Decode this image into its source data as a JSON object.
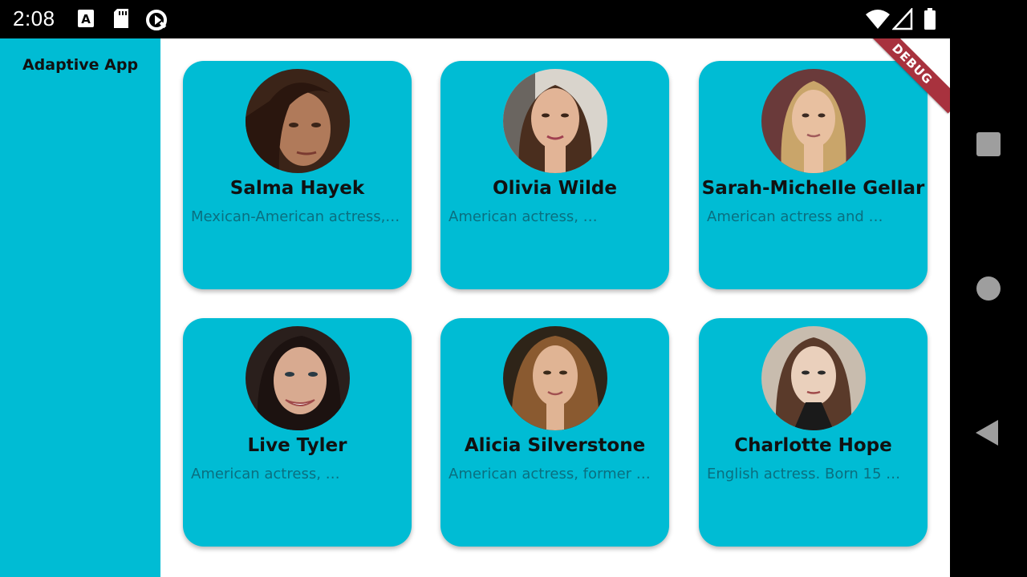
{
  "status_bar": {
    "time": "2:08",
    "left_icons": [
      "font-download-icon",
      "sd-card-icon",
      "sync-icon"
    ],
    "right_icons": [
      "wifi-icon",
      "cell-signal-icon",
      "battery-icon"
    ]
  },
  "app": {
    "title": "Adaptive App",
    "debug_label": "DEBUG"
  },
  "cards": [
    {
      "name": "Salma Hayek",
      "desc": "Mexican-American actress, …",
      "avatar_color": "#5a3b2a"
    },
    {
      "name": "Olivia Wilde",
      "desc": "American actress, …",
      "avatar_color": "#c28b6e"
    },
    {
      "name": "Sarah-Michelle Gellar",
      "desc": "American actress and …",
      "avatar_color": "#8a5a4a"
    },
    {
      "name": "Live Tyler",
      "desc": "American actress, …",
      "avatar_color": "#3d2a26"
    },
    {
      "name": "Alicia Silverstone",
      "desc": "American actress, former …",
      "avatar_color": "#7a5230"
    },
    {
      "name": "Charlotte Hope",
      "desc": "English actress. Born 15 …",
      "avatar_color": "#6e5446"
    }
  ],
  "nav": [
    "recents-button",
    "home-button",
    "back-button"
  ],
  "colors": {
    "primary": "#00BCD4",
    "desc_text": "#0a6f80",
    "debug_banner": "#a8323e"
  }
}
